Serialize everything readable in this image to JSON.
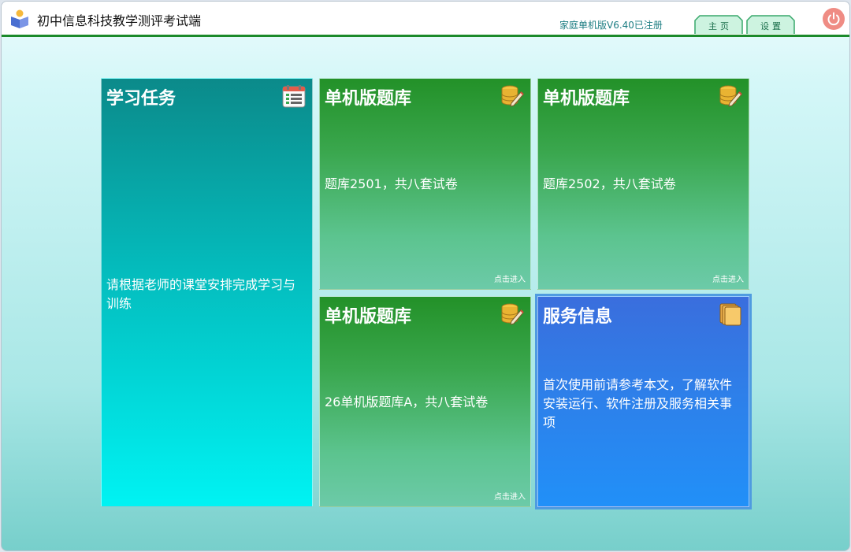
{
  "window": {
    "title": "初中信息科技教学测评考试端",
    "version": "家庭单机版V6.40已注册",
    "tabs": [
      "主页",
      "设置"
    ]
  },
  "tiles": [
    {
      "title": "学习任务",
      "desc": "请根据老师的课堂安排完成学习与训练",
      "enter": "",
      "icon": "task-list-icon",
      "color": "#04bcbd"
    },
    {
      "title": "单机版题库",
      "desc": "题库2501，共八套试卷",
      "enter": "点击进入",
      "icon": "database-edit-icon",
      "color": "#239128"
    },
    {
      "title": "单机版题库",
      "desc": "题库2502，共八套试卷",
      "enter": "点击进入",
      "icon": "database-edit-icon",
      "color": "#239128"
    },
    {
      "title": "单机版题库",
      "desc": "26单机版题库A，共八套试卷",
      "enter": "点击进入",
      "icon": "database-edit-icon",
      "color": "#239128"
    },
    {
      "title": "服务信息",
      "desc": "首次使用前请参考本文，了解软件安装运行、软件注册及服务相关事项",
      "enter": "",
      "icon": "documents-icon",
      "color": "#2e7fe9"
    }
  ]
}
